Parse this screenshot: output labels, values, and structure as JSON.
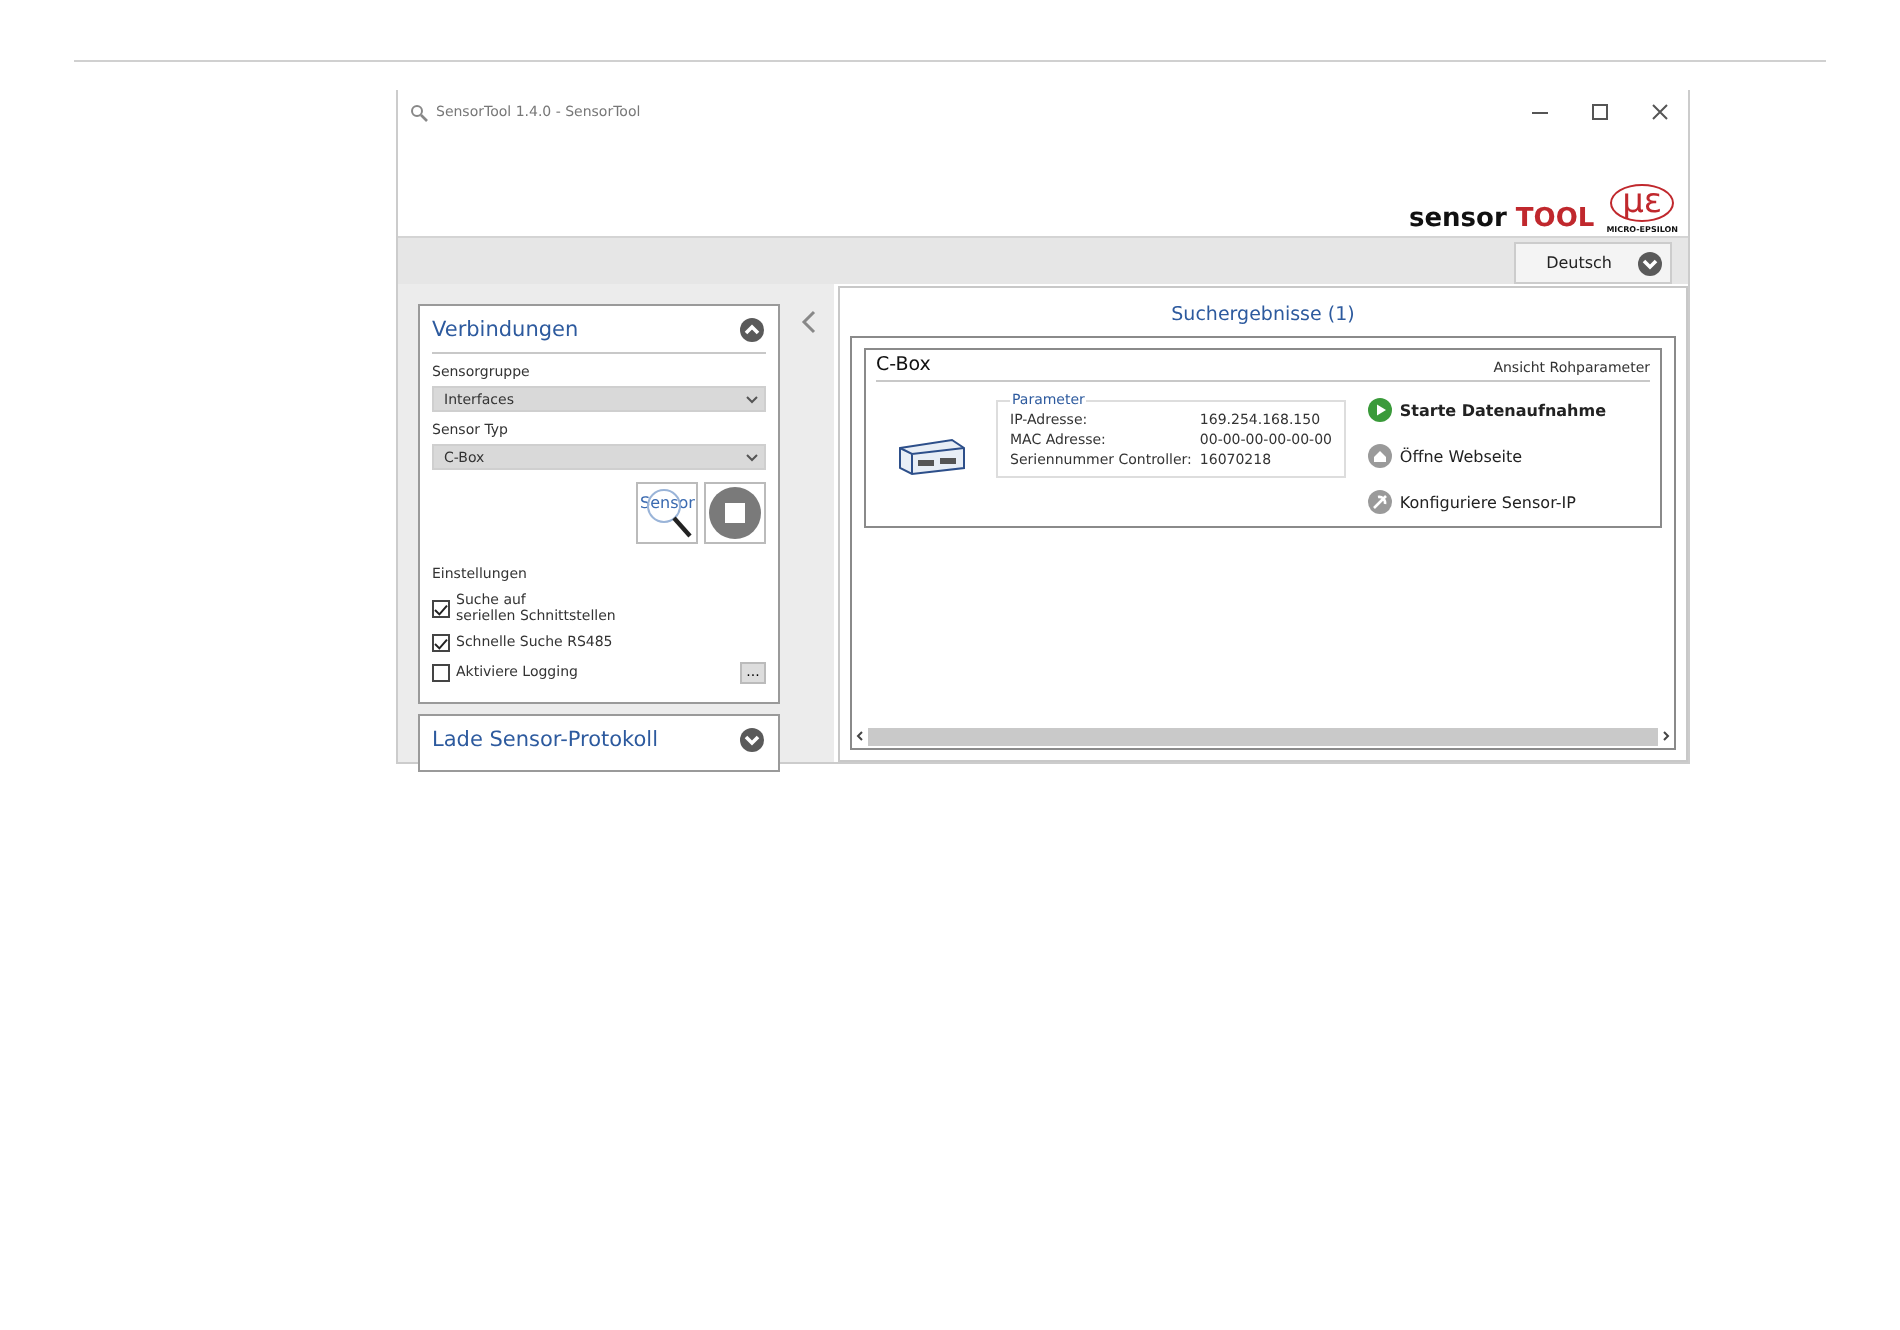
{
  "window": {
    "title": "SensorTool 1.4.0 - SensorTool"
  },
  "logo": {
    "prefix": "sensor",
    "suffix": "TOOL",
    "mark": "με",
    "company": "MICRO-EPSILON"
  },
  "language": {
    "value": "Deutsch"
  },
  "sidebar": {
    "sections": [
      {
        "title": "Verbindungen",
        "expanded": true
      },
      {
        "title": "Lade Sensor-Protokoll",
        "expanded": false
      }
    ],
    "fields": [
      {
        "label": "Sensorgruppe",
        "value": "Interfaces"
      },
      {
        "label": "Sensor Typ",
        "value": "C-Box"
      }
    ],
    "search_button": "Sensor",
    "settings_title": "Einstellungen",
    "options": [
      {
        "label": "Suche auf\nseriellen Schnittstellen",
        "checked": true
      },
      {
        "label": "Schnelle Suche RS485",
        "checked": true
      },
      {
        "label": "Aktiviere Logging",
        "checked": false
      }
    ],
    "more_button": "..."
  },
  "results": {
    "title": "Suchergebnisse (1)",
    "devices": [
      {
        "name": "C-Box",
        "raw_view_link": "Ansicht Rohparameter",
        "parameters_title": "Parameter",
        "parameters": [
          {
            "label": "IP-Adresse:",
            "value": "169.254.168.150"
          },
          {
            "label": "MAC Adresse:",
            "value": "00-00-00-00-00-00"
          },
          {
            "label": "Seriennummer Controller:",
            "value": "16070218"
          }
        ],
        "actions": [
          {
            "kind": "start",
            "label": "Starte Datenaufnahme"
          },
          {
            "kind": "web",
            "label": "Öffne Webseite"
          },
          {
            "kind": "config",
            "label": "Konfiguriere Sensor-IP"
          }
        ]
      }
    ]
  }
}
